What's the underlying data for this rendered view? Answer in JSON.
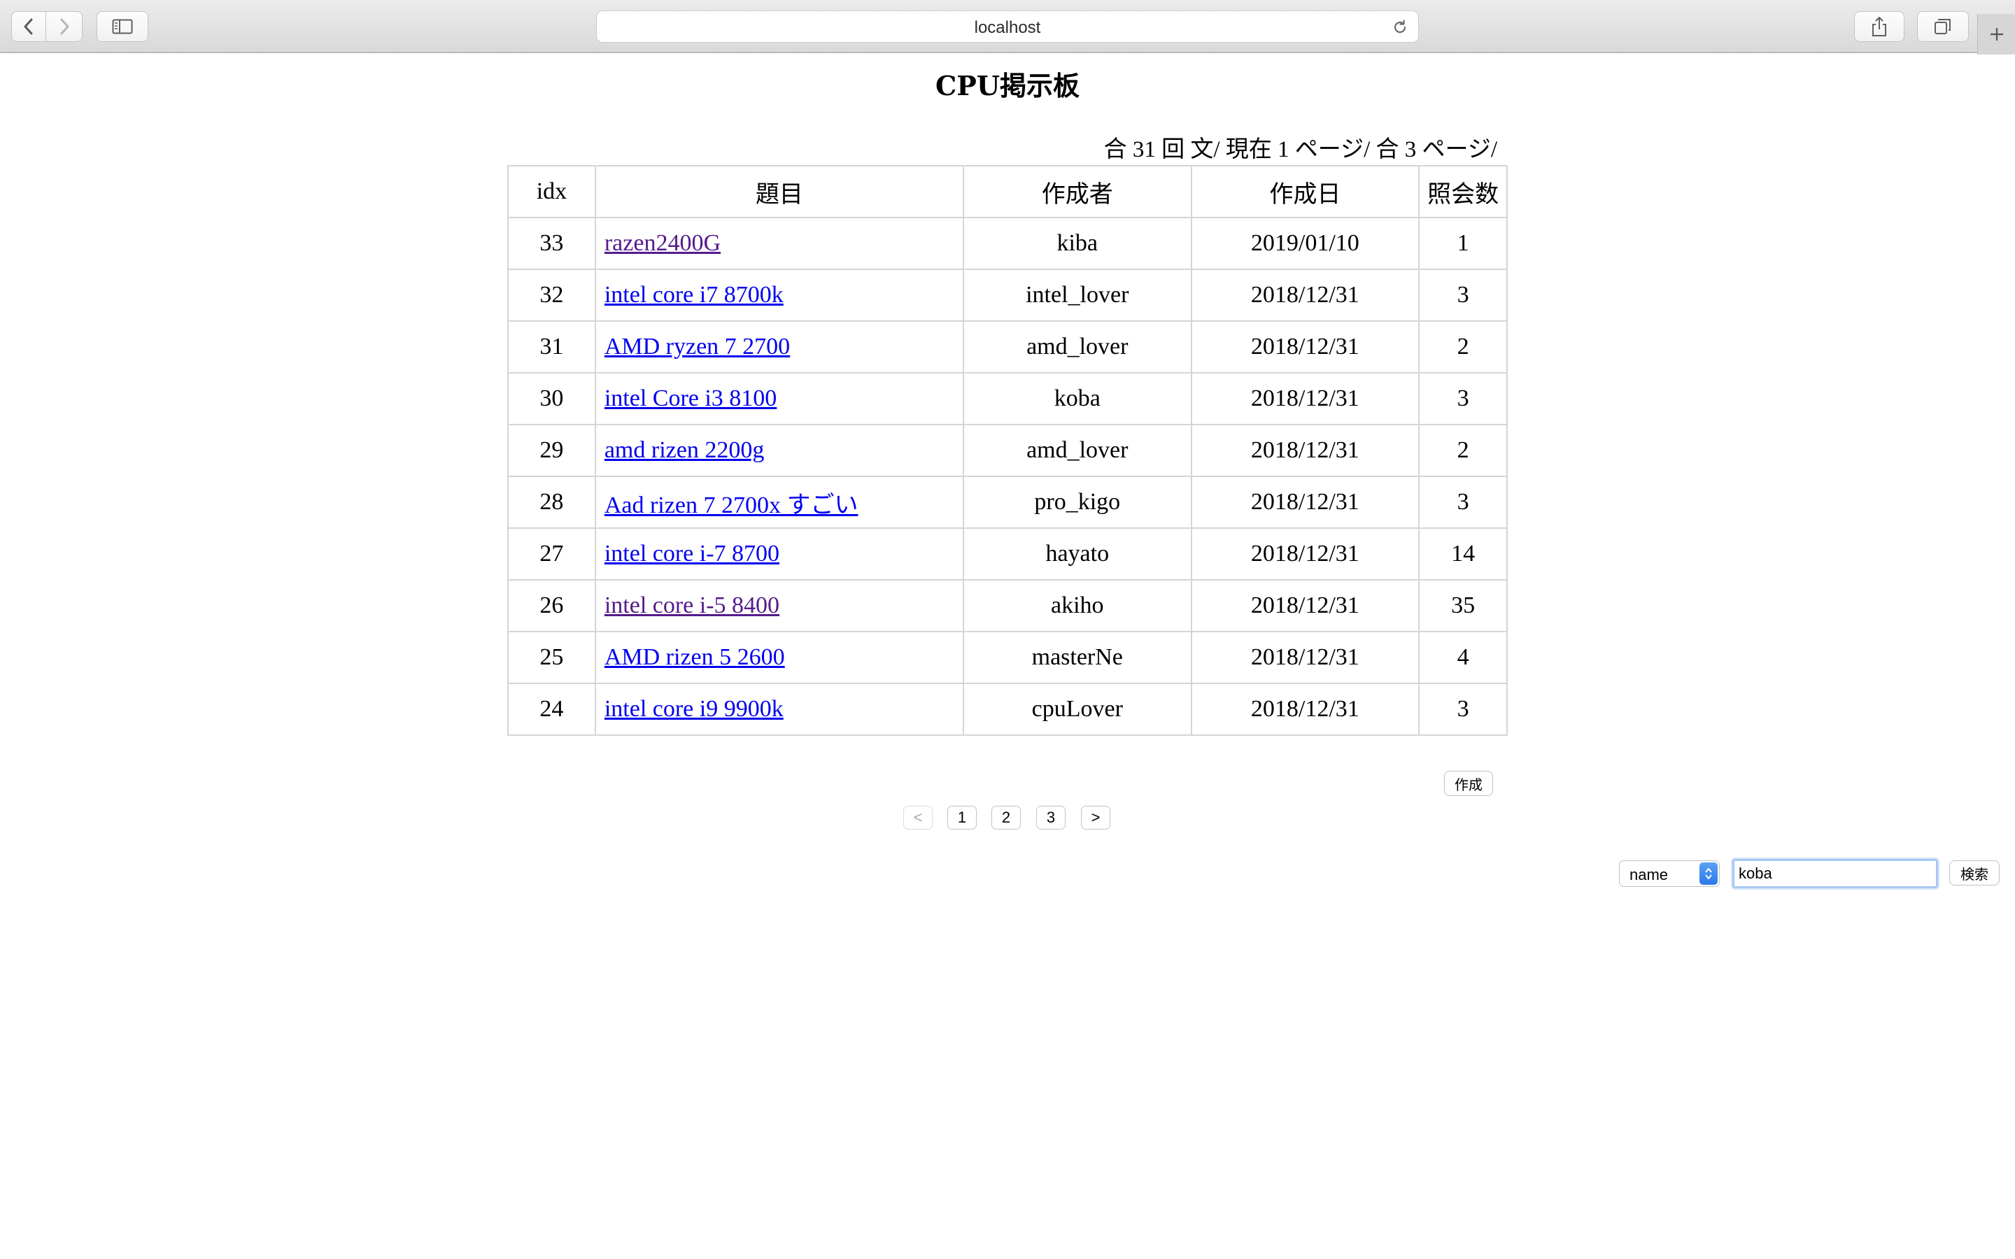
{
  "browser": {
    "url": "localhost",
    "icons": [
      "back-icon",
      "forward-icon",
      "sidebar-icon",
      "reload-icon",
      "share-icon",
      "tabs-icon",
      "new-tab-icon"
    ]
  },
  "page": {
    "title": "CPU掲示板",
    "page_info": "合 31 回 文/ 現在 1 ページ/ 合 3 ページ/"
  },
  "table": {
    "headers": [
      "idx",
      "題目",
      "作成者",
      "作成日",
      "照会数"
    ],
    "rows": [
      {
        "idx": "33",
        "title": "razen2400G",
        "author": "kiba",
        "date": "2019/01/10",
        "views": "1",
        "visited": true
      },
      {
        "idx": "32",
        "title": "intel core i7 8700k",
        "author": "intel_lover",
        "date": "2018/12/31",
        "views": "3",
        "visited": false
      },
      {
        "idx": "31",
        "title": "AMD ryzen 7 2700",
        "author": "amd_lover",
        "date": "2018/12/31",
        "views": "2",
        "visited": false
      },
      {
        "idx": "30",
        "title": "intel Core i3 8100",
        "author": "koba",
        "date": "2018/12/31",
        "views": "3",
        "visited": false
      },
      {
        "idx": "29",
        "title": "amd rizen 2200g",
        "author": "amd_lover",
        "date": "2018/12/31",
        "views": "2",
        "visited": false
      },
      {
        "idx": "28",
        "title": "Aad rizen 7 2700x すごい",
        "author": "pro_kigo",
        "date": "2018/12/31",
        "views": "3",
        "visited": false
      },
      {
        "idx": "27",
        "title": "intel core i-7 8700",
        "author": "hayato",
        "date": "2018/12/31",
        "views": "14",
        "visited": false
      },
      {
        "idx": "26",
        "title": "intel core i-5 8400",
        "author": "akiho",
        "date": "2018/12/31",
        "views": "35",
        "visited": true
      },
      {
        "idx": "25",
        "title": "AMD rizen 5 2600",
        "author": "masterNe",
        "date": "2018/12/31",
        "views": "4",
        "visited": false
      },
      {
        "idx": "24",
        "title": "intel core i9 9900k",
        "author": "cpuLover",
        "date": "2018/12/31",
        "views": "3",
        "visited": false
      }
    ]
  },
  "actions": {
    "create_label": "作成"
  },
  "pagination": {
    "prev": "<",
    "pages": [
      "1",
      "2",
      "3"
    ],
    "next": ">",
    "prev_disabled": true
  },
  "search": {
    "field_selected": "name",
    "query": "koba",
    "button_label": "検索"
  },
  "colors": {
    "link": "#0000ee",
    "visited_link": "#551a8b",
    "select_accent": "#2d79e8"
  }
}
